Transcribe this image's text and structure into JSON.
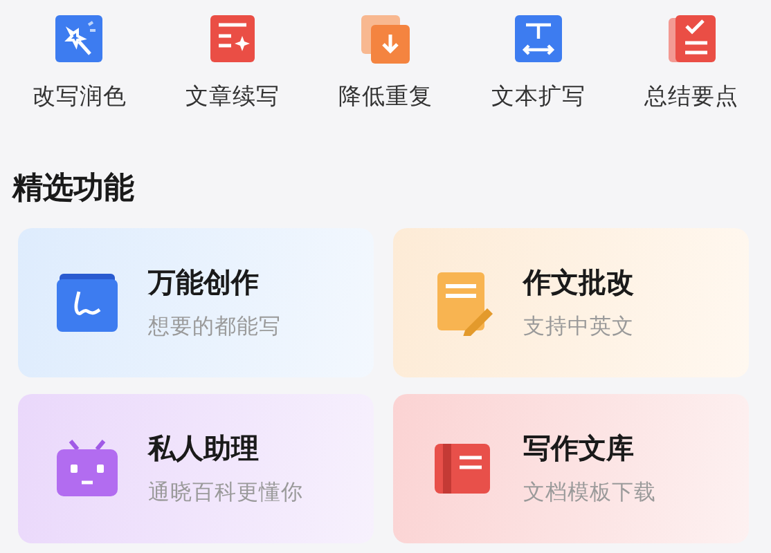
{
  "tools": [
    {
      "label": "改写润色",
      "kind": "wand",
      "color": "#3d7cf0"
    },
    {
      "label": "文章续写",
      "kind": "doc",
      "color": "#ea4e45"
    },
    {
      "label": "降低重复",
      "kind": "stack",
      "color": "#f48440"
    },
    {
      "label": "文本扩写",
      "kind": "expand",
      "color": "#3d7cf0"
    },
    {
      "label": "总结要点",
      "kind": "check",
      "color": "#ea4e45"
    }
  ],
  "section": {
    "title": "精选功能"
  },
  "cards": [
    {
      "title": "万能创作",
      "subtitle": "想要的都能写",
      "kind": "create"
    },
    {
      "title": "作文批改",
      "subtitle": "支持中英文",
      "kind": "correct"
    },
    {
      "title": "私人助理",
      "subtitle": "通晓百科更懂你",
      "kind": "assistant"
    },
    {
      "title": "写作文库",
      "subtitle": "文档模板下载",
      "kind": "library"
    }
  ]
}
